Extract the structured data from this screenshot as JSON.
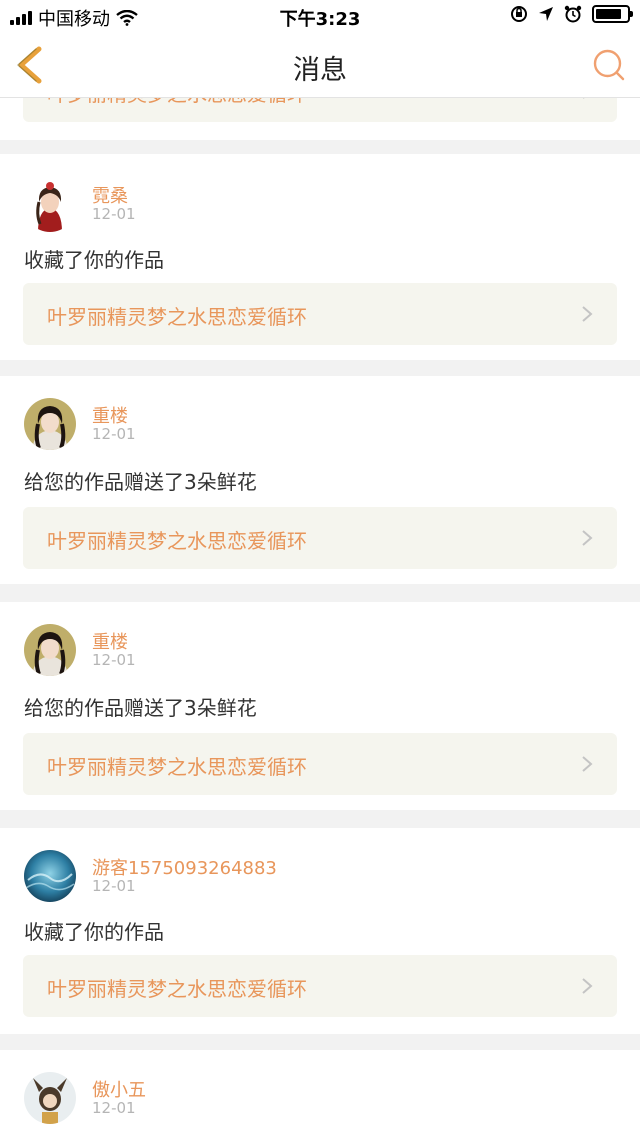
{
  "status_bar": {
    "carrier": "中国移动",
    "time": "下午3:23",
    "battery_level": 0.85
  },
  "nav": {
    "title": "消息",
    "back_icon": "chevron-left-icon",
    "search_icon": "search-icon",
    "accent": "#e8a13b"
  },
  "colors": {
    "username": "#e8965b",
    "link_bg": "#f5f5ee",
    "page_bg": "#f2f2f2"
  },
  "partial_top_link": {
    "title": "叶罗丽精灵梦之水思恋爱循环"
  },
  "messages": [
    {
      "username": "霓桑",
      "date": "12-01",
      "action": "收藏了你的作品",
      "work_title": "叶罗丽精灵梦之水思恋爱循环"
    },
    {
      "username": "重楼",
      "date": "12-01",
      "action": "给您的作品赠送了3朵鲜花",
      "work_title": "叶罗丽精灵梦之水思恋爱循环"
    },
    {
      "username": "重楼",
      "date": "12-01",
      "action": "给您的作品赠送了3朵鲜花",
      "work_title": "叶罗丽精灵梦之水思恋爱循环"
    },
    {
      "username": "游客1575093264883",
      "date": "12-01",
      "action": "收藏了你的作品",
      "work_title": "叶罗丽精灵梦之水思恋爱循环"
    },
    {
      "username": "傲小五",
      "date": "12-01"
    }
  ]
}
